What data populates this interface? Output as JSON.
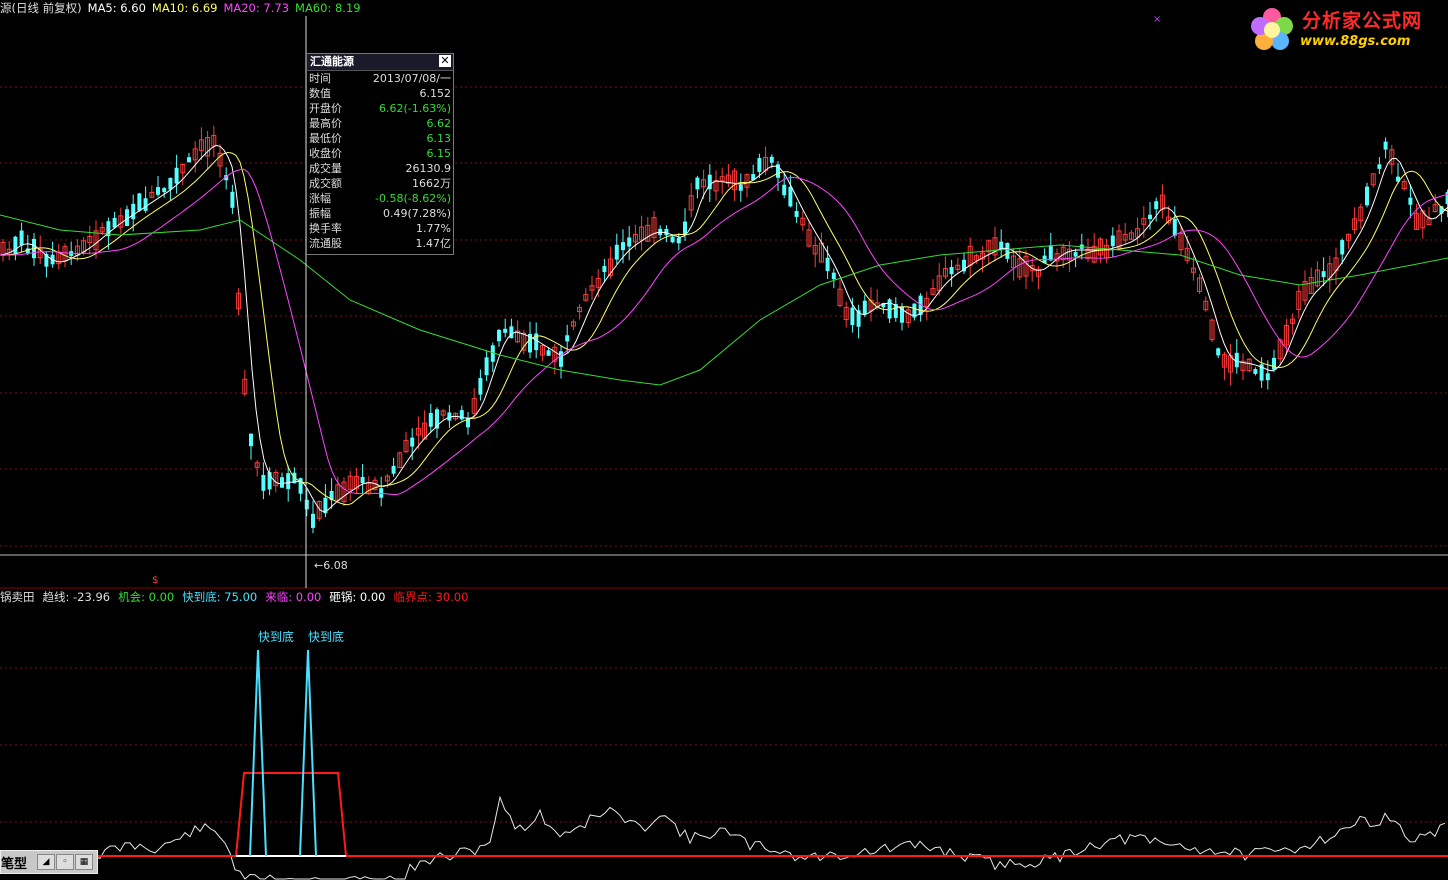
{
  "main_header": {
    "title": "源(日线 前复权)",
    "ma5": "MA5: 6.60",
    "ma10": "MA10: 6.69",
    "ma20": "MA20: 7.73",
    "ma60": "MA60: 8.19"
  },
  "colors": {
    "up": "#ff3b3b",
    "down": "#54ffff",
    "ma5": "#ffffff",
    "ma10": "#ffff66",
    "ma20": "#ff44ff",
    "ma60": "#33dd33",
    "grid": "#7a1010",
    "indicator_red": "#ff1a1a",
    "indicator_cyan": "#4ae0ff"
  },
  "tooltip": {
    "title": "汇通能源",
    "rows": [
      {
        "label": "时间",
        "value": "2013/07/08/一",
        "color": "#dddddd"
      },
      {
        "label": "数值",
        "value": "6.152",
        "color": "#dddddd"
      },
      {
        "label": "开盘价",
        "value": "6.62(-1.63%)",
        "color": "#33dd33"
      },
      {
        "label": "最高价",
        "value": "6.62",
        "color": "#33dd33"
      },
      {
        "label": "最低价",
        "value": "6.13",
        "color": "#33dd33"
      },
      {
        "label": "收盘价",
        "value": "6.15",
        "color": "#33dd33"
      },
      {
        "label": "成交量",
        "value": "26130.9",
        "color": "#dddddd"
      },
      {
        "label": "成交额",
        "value": "1662万",
        "color": "#dddddd"
      },
      {
        "label": "涨幅",
        "value": "-0.58(-8.62%)",
        "color": "#33dd33"
      },
      {
        "label": "振幅",
        "value": "0.49(7.28%)",
        "color": "#dddddd"
      },
      {
        "label": "换手率",
        "value": "1.77%",
        "color": "#dddddd"
      },
      {
        "label": "流通股",
        "value": "1.47亿",
        "color": "#dddddd"
      }
    ]
  },
  "low_marker": "6.08",
  "indicator_header": {
    "name": "锅卖田",
    "trend": "趋线: -23.96",
    "chance": "机会: 0.00",
    "near_bottom": "快到底: 75.00",
    "coming": "来临: 0.00",
    "smash": "砸锅: 0.00",
    "critical": "临界点: 30.00"
  },
  "signal_labels": [
    "快到底",
    "快到底"
  ],
  "logo": {
    "title": "分析家公式网",
    "url": "www.88gs.com"
  },
  "toolbar": {
    "label": "笔型",
    "btn1": "◢",
    "btn2": "◦",
    "btn3": "▦"
  },
  "chart_data": [
    {
      "type": "candlestick",
      "title": "汇通能源",
      "period": "日线 前复权",
      "series": [
        {
          "name": "MA5",
          "last": 6.6
        },
        {
          "name": "MA10",
          "last": 6.69
        },
        {
          "name": "MA20",
          "last": 7.73
        },
        {
          "name": "MA60",
          "last": 8.19
        }
      ],
      "annotation": {
        "text": "6.08",
        "meaning": "period low"
      }
    },
    {
      "type": "line",
      "title": "锅卖田",
      "series": [
        {
          "name": "趋线",
          "last": -23.96
        },
        {
          "name": "机会",
          "last": 0.0
        },
        {
          "name": "快到底",
          "last": 75.0
        },
        {
          "name": "来临",
          "last": 0.0
        },
        {
          "name": "砸锅",
          "last": 0.0
        },
        {
          "name": "临界点",
          "last": 30.0
        }
      ]
    }
  ]
}
